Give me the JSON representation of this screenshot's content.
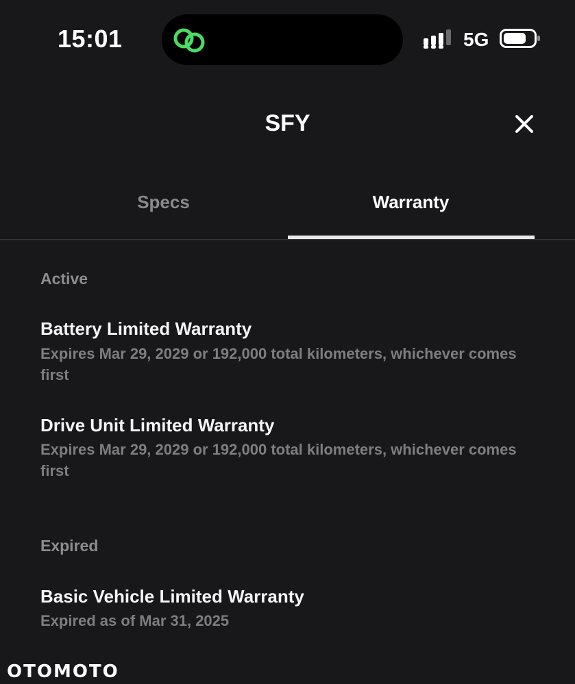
{
  "status_bar": {
    "time": "15:01",
    "network": "5G",
    "island_icon": "link-icon",
    "colors": {
      "island_icon": "#4cd964"
    }
  },
  "header": {
    "title": "SFY",
    "close_icon": "close-icon"
  },
  "tabs": [
    {
      "label": "Specs",
      "active": false
    },
    {
      "label": "Warranty",
      "active": true
    }
  ],
  "sections": [
    {
      "label": "Active",
      "items": [
        {
          "title": "Battery Limited Warranty",
          "description": "Expires Mar 29, 2029 or 192,000 total kilometers, whichever comes first"
        },
        {
          "title": "Drive Unit Limited Warranty",
          "description": "Expires Mar 29, 2029 or 192,000 total kilometers, whichever comes first"
        }
      ]
    },
    {
      "label": "Expired",
      "items": [
        {
          "title": "Basic Vehicle Limited Warranty",
          "description": "Expired as of Mar 31, 2025"
        }
      ]
    }
  ],
  "watermark": "OTOMOTO"
}
